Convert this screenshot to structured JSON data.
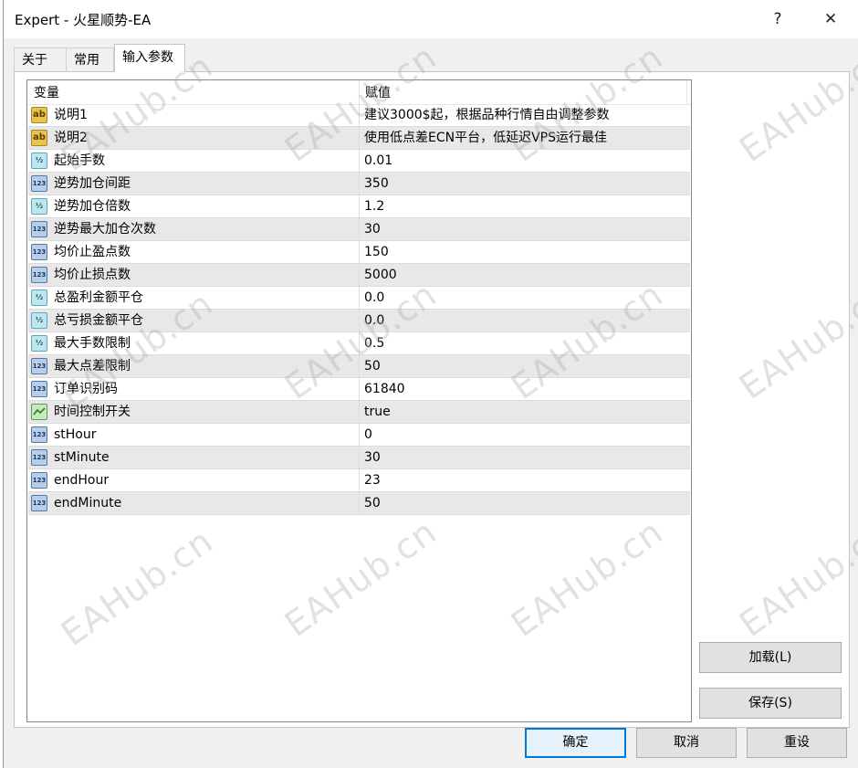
{
  "window": {
    "title": "Expert - 火星顺势-EA",
    "help_glyph": "?",
    "close_glyph": "✕"
  },
  "tabs": [
    {
      "label": "关于"
    },
    {
      "label": "常用"
    },
    {
      "label": "输入参数"
    }
  ],
  "grid": {
    "headers": {
      "variable": "变量",
      "value": "赋值"
    },
    "rows": [
      {
        "name": "说明1",
        "value": "建议3000$起，根据品种行情自由调整参数",
        "type": "string-icon"
      },
      {
        "name": "说明2",
        "value": "使用低点差ECN平台，低延迟VPS运行最佳",
        "type": "string-icon"
      },
      {
        "name": "起始手数",
        "value": "0.01",
        "type": "double-icon"
      },
      {
        "name": "逆势加仓间距",
        "value": "350",
        "type": "integer-icon"
      },
      {
        "name": "逆势加仓倍数",
        "value": "1.2",
        "type": "double-icon"
      },
      {
        "name": "逆势最大加仓次数",
        "value": "30",
        "type": "integer-icon"
      },
      {
        "name": "均价止盈点数",
        "value": "150",
        "type": "integer-icon"
      },
      {
        "name": "均价止损点数",
        "value": "5000",
        "type": "integer-icon"
      },
      {
        "name": "总盈利金额平仓",
        "value": "0.0",
        "type": "double-icon"
      },
      {
        "name": "总亏损金额平仓",
        "value": "0.0",
        "type": "double-icon"
      },
      {
        "name": "最大手数限制",
        "value": "0.5",
        "type": "double-icon"
      },
      {
        "name": "最大点差限制",
        "value": "50",
        "type": "integer-icon"
      },
      {
        "name": "订单识别码",
        "value": "61840",
        "type": "integer-icon"
      },
      {
        "name": "时间控制开关",
        "value": "true",
        "type": "boolean-icon"
      },
      {
        "name": "stHour",
        "value": "0",
        "type": "integer-icon"
      },
      {
        "name": "stMinute",
        "value": "30",
        "type": "integer-icon"
      },
      {
        "name": "endHour",
        "value": "23",
        "type": "integer-icon"
      },
      {
        "name": "endMinute",
        "value": "50",
        "type": "integer-icon"
      }
    ]
  },
  "icon_glyphs": {
    "string-icon": "ab",
    "double-icon": "½",
    "integer-icon": "123",
    "boolean-icon": ""
  },
  "buttons": {
    "load": "加载(L)",
    "save": "保存(S)",
    "ok": "确定",
    "cancel": "取消",
    "reset": "重设"
  },
  "watermark": "EAHub.cn",
  "colors": {
    "accent": "#0078d7",
    "row_alt": "#e8e8e8"
  }
}
